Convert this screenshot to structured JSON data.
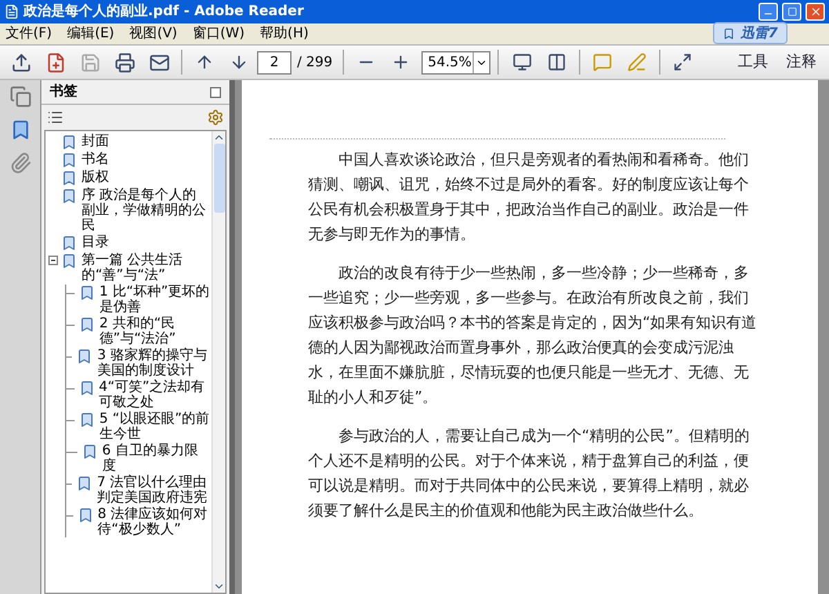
{
  "window": {
    "title": "政治是每个人的副业.pdf - Adobe Reader"
  },
  "menu": [
    "文件(F)",
    "编辑(E)",
    "视图(V)",
    "窗口(W)",
    "帮助(H)"
  ],
  "overlay_badge": "迅雷7",
  "toolbar": {
    "page": "2",
    "page_count": "/ 299",
    "zoom": "54.5%",
    "right_tabs": [
      "工具",
      "注释"
    ]
  },
  "bookmarks_panel": {
    "title": "书签",
    "items": [
      {
        "label": "封面"
      },
      {
        "label": "书名"
      },
      {
        "label": "版权"
      },
      {
        "label": "序 政治是每个人的副业，学做精明的公民"
      },
      {
        "label": "目录"
      },
      {
        "label": "第一篇 公共生活的“善”与“法”",
        "expanded": true,
        "children": [
          {
            "label": "1 比“坏种”更坏的是伪善"
          },
          {
            "label": "2 共和的“民德”与“法治”"
          },
          {
            "label": "3 骆家辉的操守与美国的制度设计"
          },
          {
            "label": "4“可笑”之法却有可敬之处"
          },
          {
            "label": "5 “以眼还眼”的前生今世"
          },
          {
            "label": "6 自卫的暴力限度"
          },
          {
            "label": "7 法官以什么理由判定美国政府违宪"
          },
          {
            "label": "8 法律应该如何对待“极少数人”"
          }
        ]
      }
    ]
  },
  "document": {
    "paragraphs": [
      "中国人喜欢谈论政治，但只是旁观者的看热闹和看稀奇。他们猜测、嘲讽、诅咒，始终不过是局外的看客。好的制度应该让每个公民有机会积极置身于其中，把政治当作自己的副业。政治是一件无参与即无作为的事情。",
      "政治的改良有待于少一些热闹，多一些冷静；少一些稀奇，多一些追究；少一些旁观，多一些参与。在政治有所改良之前，我们应该积极参与政治吗？本书的答案是肯定的，因为“如果有知识有道德的人因为鄙视政治而置身事外，那么政治便真的会变成污泥浊水，在里面不嫌肮脏，尽情玩耍的也便只能是一些无才、无德、无耻的小人和歹徒”。",
      "参与政治的人，需要让自己成为一个“精明的公民”。但精明的个人还不是精明的公民。对于个体来说，精于盘算自己的利益，便可以说是精明。而对于共同体中的公民来说，要算得上精明，就必须要了解什么是民主的价值观和他能为民主政治做些什么。"
    ]
  }
}
